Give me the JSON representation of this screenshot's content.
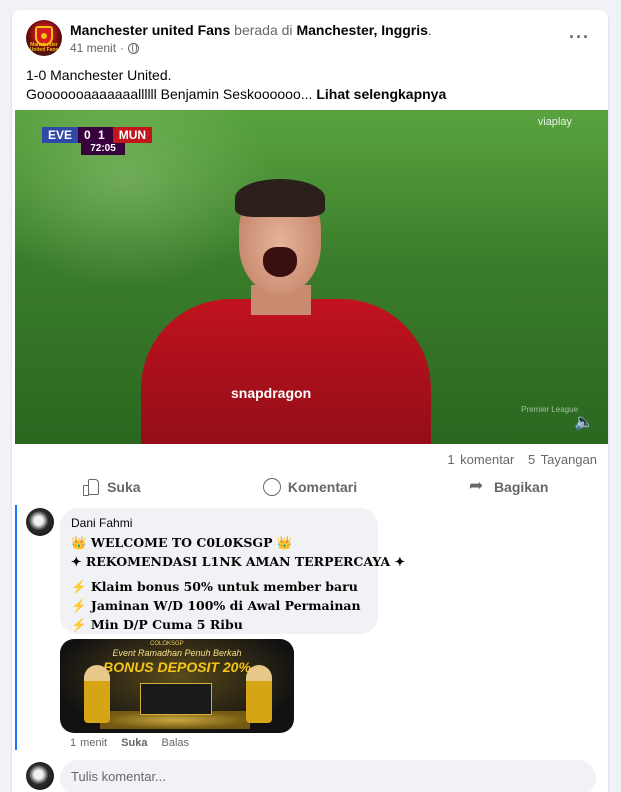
{
  "post": {
    "page_name": "Manchester united Fans",
    "location_prefix": "berada di",
    "location": "Manchester, Inggris",
    "location_suffix": ".",
    "avatar_caption": "Manchester United Fans",
    "time": "41 menit",
    "separator": "·",
    "more_icon": "more-horizontal-icon",
    "text_line1": "1-0 Manchester United.",
    "text_line2": "Gooooooaaaaaaallllll Benjamin Seskoooooo...",
    "see_more": "Lihat selengkapnya"
  },
  "media": {
    "home_team": "EVE",
    "score": "0 1",
    "away_team": "MUN",
    "clock": "72:05",
    "watermark": "viaplay",
    "bottom_mark": "Premier League",
    "jersey_sponsor": "snapdragon",
    "volume_icon": "volume-icon"
  },
  "stats": {
    "comments": "1 komentar",
    "views": "5 Tayangan"
  },
  "actions": {
    "like": "Suka",
    "comment": "Komentari",
    "share": "Bagikan"
  },
  "comment": {
    "author": "Dani Fahmi",
    "lines": [
      "👑 WELCOME TO C0L0KSGP 👑",
      "✦ REKOMENDASI L1NK AMAN TERPERCAYA ✦",
      "⚡ Klaim bonus 50% untuk member baru",
      "⚡ Jaminan W/D 100% di Awal Permainan",
      "⚡ Min D/P Cuma 5 Ribu"
    ],
    "promo_logo": "COLOKSGP",
    "promo_line1": "Event Ramadhan Penuh Berkah",
    "promo_line2": "BONUS DEPOSIT 20%",
    "time": "1 menit",
    "like": "Suka",
    "reply": "Balas"
  },
  "composer": {
    "placeholder": "Tulis komentar..."
  }
}
